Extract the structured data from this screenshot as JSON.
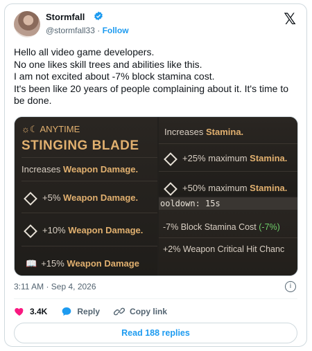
{
  "author": {
    "name": "Stormfall",
    "handle": "@stormfall33",
    "follow_label": "Follow",
    "dot": "·"
  },
  "post": {
    "text": "Hello all video game developers.\nNo one likes skill trees and abilities like this.\nI am not excited about -7% block stamina cost.\nIt's been like 20 years of people complaining about it. It's time to be done."
  },
  "media": {
    "tile1": {
      "tag": "ANYTIME",
      "title": "STINGING BLADE",
      "desc_prefix": "Increases ",
      "desc_highlight": "Weapon Damage.",
      "rows": [
        {
          "value": "+5% ",
          "stat": "Weapon Damage."
        },
        {
          "value": "+10% ",
          "stat": "Weapon Damage."
        },
        {
          "value": "+15% ",
          "stat": "Weapon Damage"
        }
      ]
    },
    "tile2": {
      "desc_prefix": "Increases ",
      "desc_highlight": "Stamina.",
      "rows": [
        {
          "value": "+25% maximum ",
          "stat": "Stamina."
        },
        {
          "value": "+50% maximum ",
          "stat": "Stamina."
        }
      ]
    },
    "tile3": {
      "cooldown": "ooldown: 15s",
      "row1_prefix": "-7% Block Stamina Cost ",
      "row1_green": "(-7%)",
      "row2": "+2% Weapon Critical Hit Chanc"
    }
  },
  "meta": {
    "time": "3:11 AM · Sep 4, 2026"
  },
  "actions": {
    "likes": "3.4K",
    "reply": "Reply",
    "copy": "Copy link"
  },
  "read_replies": "Read 188 replies",
  "colors": {
    "accent": "#1d9bf0",
    "like": "#f91880",
    "gold": "#e1b06f"
  }
}
